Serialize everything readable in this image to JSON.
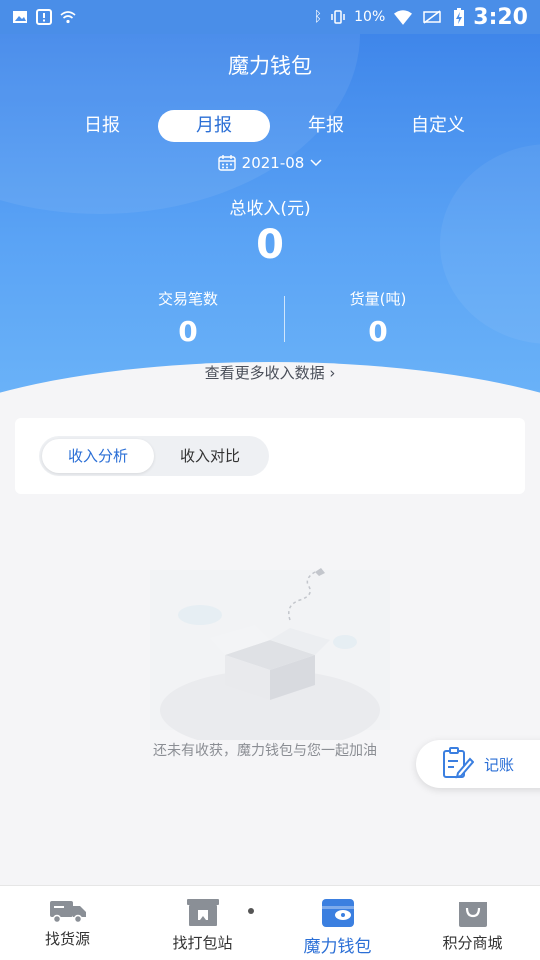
{
  "status_bar": {
    "battery_text": "10",
    "battery_percent_sign": "%",
    "time": "3:20"
  },
  "header": {
    "title": "魔力钱包",
    "period_tabs": [
      "日报",
      "月报",
      "年报",
      "自定义"
    ],
    "selected_period": "月报",
    "date": "2021-08",
    "total_income_label": "总收入(元)",
    "total_income_value": "0",
    "transactions_label": "交易笔数",
    "transactions_value": "0",
    "cargo_label": "货量(吨)",
    "cargo_value": "0",
    "more_link": "查看更多收入数据 ›"
  },
  "analysis": {
    "tabs": [
      "收入分析",
      "收入对比"
    ],
    "selected_tab": "收入分析"
  },
  "empty_state": {
    "message": "还未有收获，魔力钱包与您一起加油"
  },
  "fab": {
    "label": "记账"
  },
  "bottom_nav": [
    {
      "label": "找货源",
      "icon": "truck-icon"
    },
    {
      "label": "找打包站",
      "icon": "package-station-icon"
    },
    {
      "label": "魔力钱包",
      "icon": "wallet-icon"
    },
    {
      "label": "积分商城",
      "icon": "shopping-bag-icon"
    }
  ],
  "colors": {
    "primary": "#2b6fd6",
    "header_top": "#3f86ea",
    "header_bottom": "#6bb3f8",
    "background": "#f5f5f7"
  }
}
